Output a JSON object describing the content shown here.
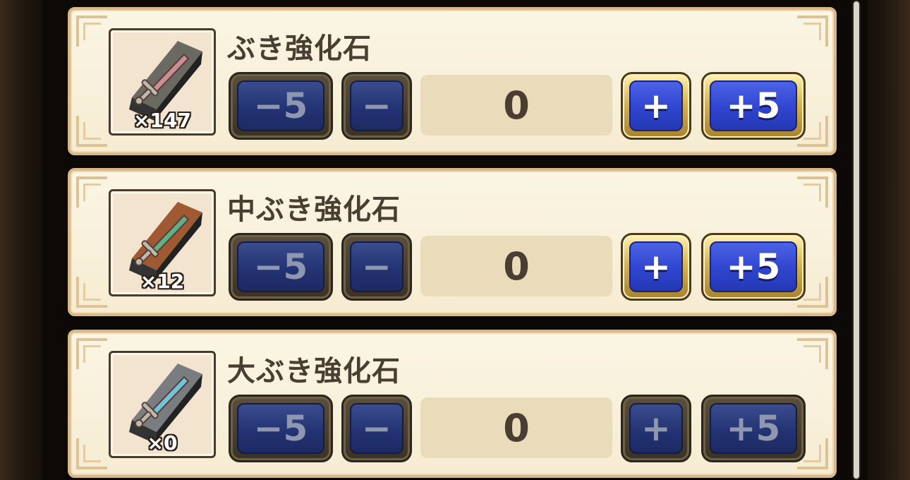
{
  "items": [
    {
      "name": "ぶき強化石",
      "count": "×147",
      "quantity": "0",
      "icon": "sword-on-stone-icon",
      "stone_color": "#6a6a62",
      "blade_color": "#c98f92",
      "buttons_enabled": {
        "minus5": true,
        "minus1": true,
        "plus1": true,
        "plus5": true
      }
    },
    {
      "name": "中ぶき強化石",
      "count": "×12",
      "quantity": "0",
      "icon": "sword-on-bronze-stone-icon",
      "stone_color": "#a05a33",
      "blade_color": "#5fb083",
      "buttons_enabled": {
        "minus5": true,
        "minus1": true,
        "plus1": true,
        "plus5": true
      }
    },
    {
      "name": "大ぶき強化石",
      "count": "×0",
      "quantity": "0",
      "icon": "sword-on-silver-stone-icon",
      "stone_color": "#7a7d80",
      "blade_color": "#6fc6d8",
      "buttons_enabled": {
        "minus5": true,
        "minus1": true,
        "plus1": false,
        "plus5": false
      }
    }
  ],
  "buttons": {
    "minus5": "−5",
    "minus1": "−",
    "plus1": "+",
    "plus5": "+5"
  },
  "colors": {
    "card_bg": "#f6ecd2",
    "active_button": "#2f45cf",
    "inactive_button": "#233373",
    "text": "#4a3d31"
  }
}
